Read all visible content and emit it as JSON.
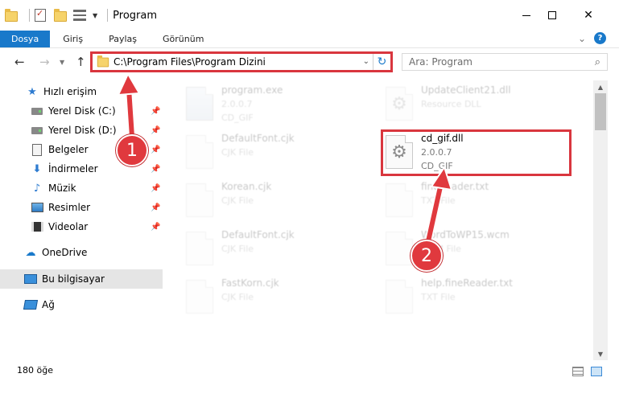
{
  "window": {
    "title": "Program",
    "min_label": "–",
    "close_label": "✕"
  },
  "ribbon": {
    "tabs": [
      "Dosya",
      "Giriş",
      "Paylaş",
      "Görünüm"
    ]
  },
  "nav": {
    "path": "C:\\Program Files\\Program Dizini",
    "search_placeholder": "Ara: Program"
  },
  "sidebar": {
    "items": [
      {
        "label": "Hızlı erişim",
        "icon": "star-icon",
        "pinned": false
      },
      {
        "label": "Yerel Disk (C:)",
        "icon": "disk-icon",
        "pinned": true
      },
      {
        "label": "Yerel Disk (D:)",
        "icon": "disk-icon",
        "pinned": true
      },
      {
        "label": "Belgeler",
        "icon": "documents-icon",
        "pinned": true
      },
      {
        "label": "İndirmeler",
        "icon": "download-icon",
        "pinned": true
      },
      {
        "label": "Müzik",
        "icon": "music-icon",
        "pinned": true
      },
      {
        "label": "Resimler",
        "icon": "pictures-icon",
        "pinned": true
      },
      {
        "label": "Videolar",
        "icon": "videos-icon",
        "pinned": true
      },
      {
        "label": "OneDrive",
        "icon": "cloud-icon",
        "pinned": false
      },
      {
        "label": "Bu bilgisayar",
        "icon": "computer-icon",
        "pinned": false,
        "selected": true
      },
      {
        "label": "Ağ",
        "icon": "network-icon",
        "pinned": false
      }
    ]
  },
  "files": [
    {
      "name": "program.exe",
      "line2": "2.0.0.7",
      "line3": "CD_GIF",
      "faded": true
    },
    {
      "name": "UpdateClient21.dll",
      "line2": "Resource DLL",
      "line3": "",
      "faded": true
    },
    {
      "name": "DefaultFont.cjk",
      "line2": "CJK File",
      "line3": "",
      "faded": true
    },
    {
      "name": "cd_gif.dll",
      "line2": "2.0.0.7",
      "line3": "CD_GIF",
      "faded": false
    },
    {
      "name": "Korean.cjk",
      "line2": "CJK File",
      "line3": "",
      "faded": true
    },
    {
      "name": "fineReader.txt",
      "line2": "TXT File",
      "line3": "",
      "faded": true
    },
    {
      "name": "DefaultFont.cjk",
      "line2": "CJK File",
      "line3": "",
      "faded": true
    },
    {
      "name": "WordToWP15.wcm",
      "line2": "WCM File",
      "line3": "",
      "faded": true
    },
    {
      "name": "FastKorn.cjk",
      "line2": "CJK File",
      "line3": "",
      "faded": true
    },
    {
      "name": "help.fineReader.txt",
      "line2": "TXT File",
      "line3": "",
      "faded": true
    }
  ],
  "status": {
    "count": "180 öğe"
  },
  "callouts": [
    "1",
    "2"
  ],
  "colors": {
    "accent": "#1979ca",
    "highlight": "#d9363e",
    "callout": "#e0393e"
  }
}
